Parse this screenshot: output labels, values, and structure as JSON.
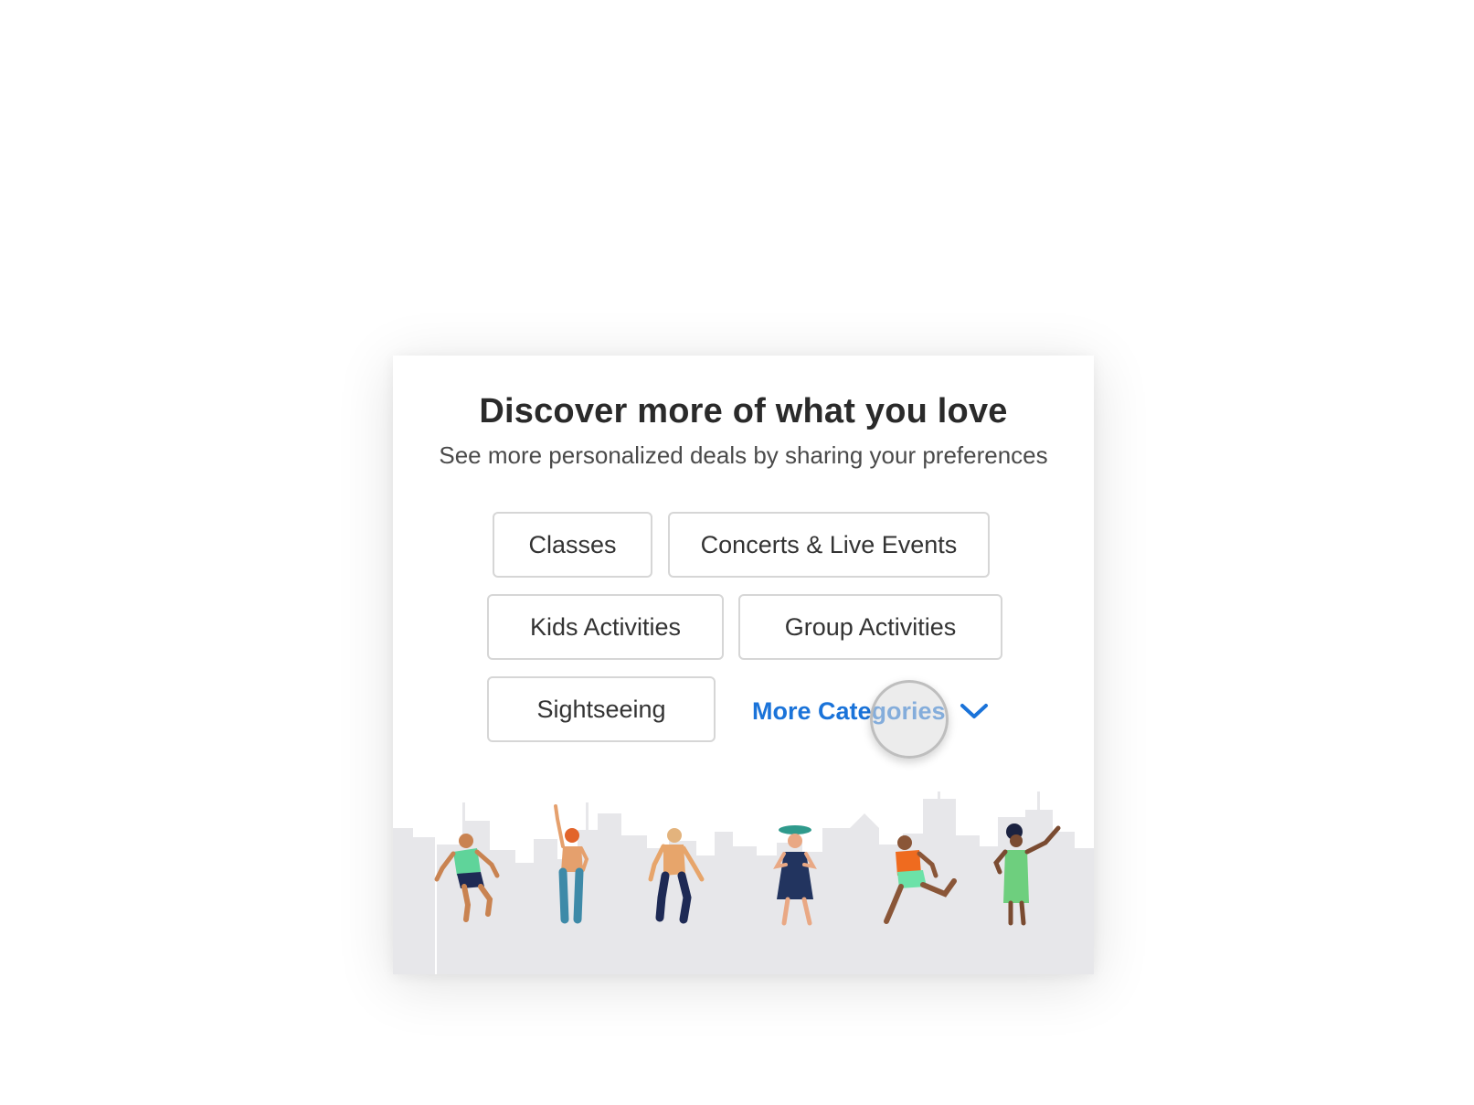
{
  "modal": {
    "title": "Discover more of what you love",
    "subtitle": "See more personalized deals by sharing your preferences"
  },
  "categories": [
    {
      "label": "Classes"
    },
    {
      "label": "Concerts & Live Events"
    },
    {
      "label": "Kids Activities"
    },
    {
      "label": "Group Activities"
    },
    {
      "label": "Sightseeing"
    }
  ],
  "more": {
    "label": "More Categories",
    "icon": "chevron-down-icon"
  },
  "colors": {
    "accent": "#1a73d9",
    "title": "#2a2a2a",
    "chip_border": "#d6d6d6",
    "skyline": "#e7e7ea"
  },
  "illustration": {
    "icon": "city-skyline-dancers-illustration"
  }
}
